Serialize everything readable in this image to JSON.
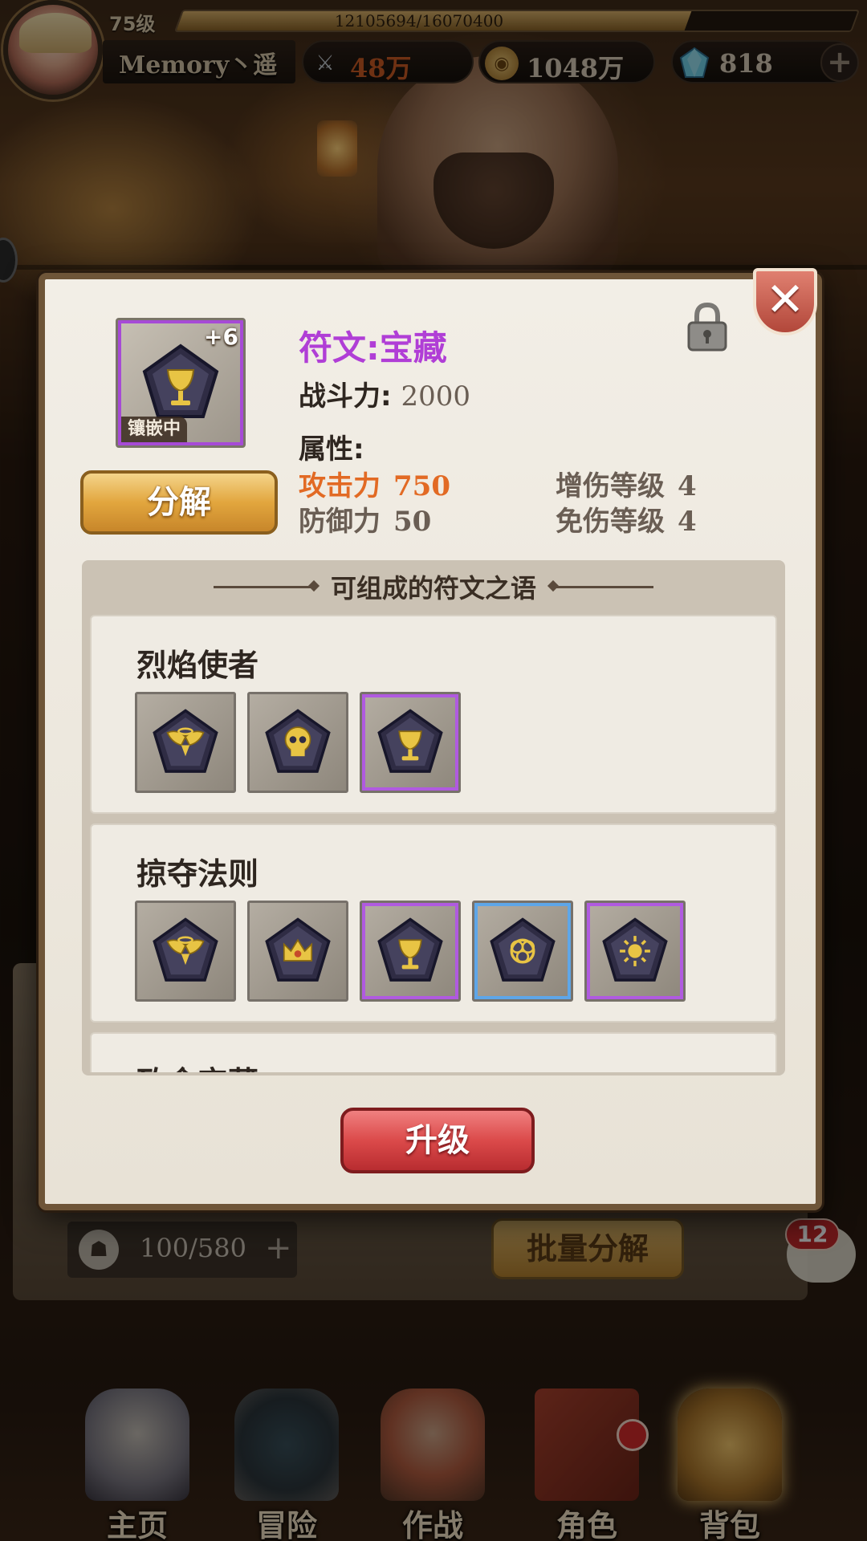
{
  "player": {
    "level": "75级",
    "exp_text": "12105694/16070400",
    "exp_fraction": 0.753,
    "name": "Memory丶遥"
  },
  "resources": [
    {
      "name": "combat-power",
      "icon": "crossed-swords-icon",
      "value": "48万",
      "color": "#c85a24"
    },
    {
      "name": "gold",
      "icon": "gold-coin-icon",
      "value": "1048万",
      "color": "#d8cbb6"
    },
    {
      "name": "gems",
      "icon": "crystal-gem-icon",
      "value": "818",
      "color": "#d8cbb6"
    }
  ],
  "dialog": {
    "rune_plus": "+6",
    "inlay_status": "镶嵌中",
    "decompose_label": "分解",
    "title": "符文:宝藏",
    "power_label": "战斗力:",
    "power_value": "2000",
    "attr_header": "属性:",
    "stats": {
      "attack": {
        "label": "攻击力",
        "value": "750"
      },
      "defense": {
        "label": "防御力",
        "value": "50"
      },
      "dmg_up": {
        "label": "增伤等级",
        "value": "4"
      },
      "dmg_down": {
        "label": "免伤等级",
        "value": "4"
      }
    },
    "section_title": "可组成的符文之语",
    "runewords": [
      {
        "name": "烈焰使者",
        "runes": [
          "wings",
          "skull",
          "chalice"
        ]
      },
      {
        "name": "掠夺法则",
        "runes": [
          "wings",
          "crown",
          "chalice",
          "knot",
          "sun"
        ]
      },
      {
        "name": "致命宝藏",
        "runes": []
      }
    ],
    "upgrade_label": "升级"
  },
  "bag": {
    "count": "100/580",
    "plus": "+",
    "batch_decompose": "批量分解",
    "chat_badge": "12"
  },
  "bottom_nav": [
    {
      "label": "主页",
      "icon": "home-angel-icon"
    },
    {
      "label": "冒险",
      "icon": "portal-icon"
    },
    {
      "label": "作战",
      "icon": "battle-girl-icon"
    },
    {
      "label": "角色",
      "icon": "hero-book-icon"
    },
    {
      "label": "背包",
      "icon": "backpack-icon"
    }
  ],
  "colors": {
    "rune_purple": "#b03ed6",
    "highlight_orange": "#e26a24",
    "upgrade_red": "#db4a4a",
    "decompose_gold": "#e2a63e"
  }
}
